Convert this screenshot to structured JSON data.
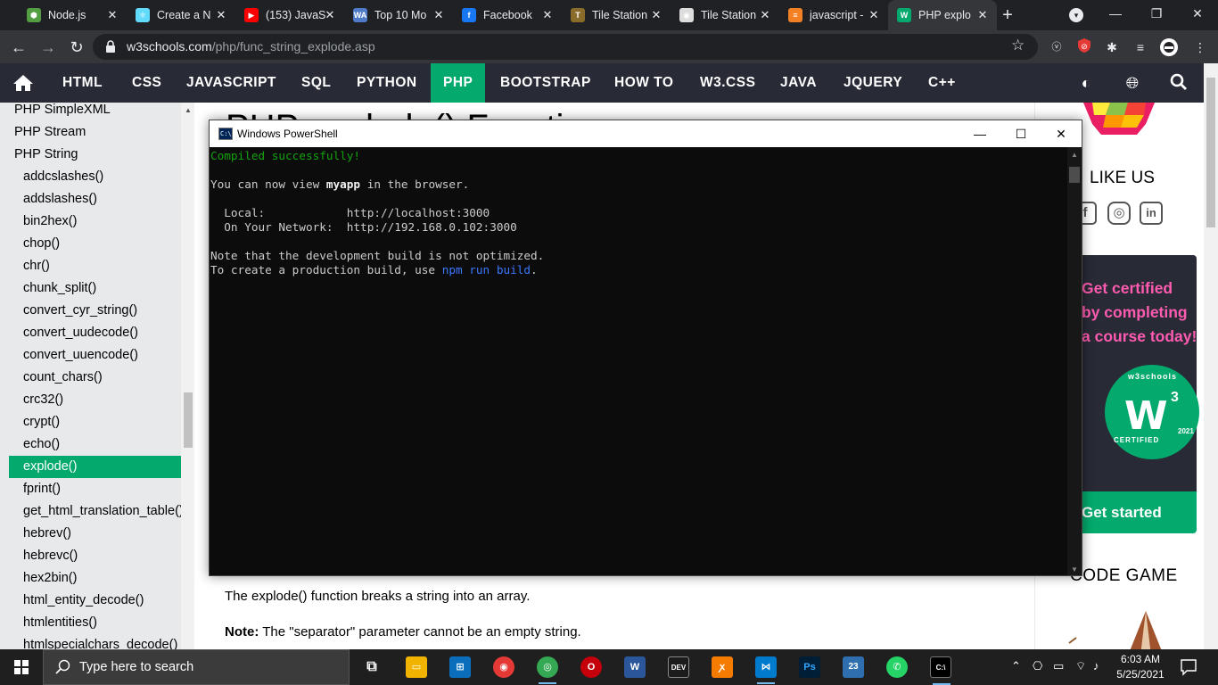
{
  "browser": {
    "tabs": [
      {
        "label": "Node.js",
        "icon": "nodejs-icon",
        "color": "#539e43",
        "glyph": "⬢"
      },
      {
        "label": "Create a N",
        "icon": "react-icon",
        "color": "#61dafb",
        "glyph": "⚛"
      },
      {
        "label": "(153) JavaS",
        "icon": "youtube-icon",
        "color": "#ff0000",
        "glyph": "▶"
      },
      {
        "label": "Top 10 Mo",
        "icon": "w3-logo-icon",
        "color": "#4e7cc9",
        "glyph": "WA"
      },
      {
        "label": "Facebook",
        "icon": "facebook-icon",
        "color": "#1877f2",
        "glyph": "f"
      },
      {
        "label": "Tile Station",
        "icon": "tile-station-icon",
        "color": "#8a6d2b",
        "glyph": "T"
      },
      {
        "label": "Tile Station",
        "icon": "globe-icon",
        "color": "#dddddd",
        "glyph": "◉"
      },
      {
        "label": "javascript -",
        "icon": "stackoverflow-icon",
        "color": "#f48024",
        "glyph": "≡"
      },
      {
        "label": "PHP explo",
        "icon": "w3schools-icon",
        "color": "#04aa6d",
        "glyph": "W"
      }
    ],
    "url_host": "w3schools.com",
    "url_path": "/php/func_string_explode.asp"
  },
  "w3nav": {
    "items": [
      "HTML",
      "CSS",
      "JAVASCRIPT",
      "SQL",
      "PYTHON",
      "PHP",
      "BOOTSTRAP",
      "HOW TO",
      "W3.CSS",
      "JAVA",
      "JQUERY",
      "C++"
    ],
    "active": "PHP"
  },
  "sidebar": {
    "top_items": [
      "PHP SimpleXML",
      "PHP Stream",
      "PHP String"
    ],
    "sub_items": [
      "addcslashes()",
      "addslashes()",
      "bin2hex()",
      "chop()",
      "chr()",
      "chunk_split()",
      "convert_cyr_string()",
      "convert_uudecode()",
      "convert_uuencode()",
      "count_chars()",
      "crc32()",
      "crypt()",
      "echo()",
      "explode()",
      "fprint()",
      "get_html_translation_table()",
      "hebrev()",
      "hebrevc()",
      "hex2bin()",
      "html_entity_decode()",
      "htmlentities()",
      "htmlspecialchars_decode()"
    ],
    "active": "explode()"
  },
  "main": {
    "heading_fragment": "PHP explode() Function",
    "para1": "The explode() function breaks a string into an array.",
    "note_label": "Note:",
    "note_text": " The \"separator\" parameter cannot be an empty string."
  },
  "right": {
    "like_us": "LIKE US",
    "cert_lines": [
      "Get certified",
      "by completing",
      "a course today!"
    ],
    "badge_ring": "w3schools",
    "badge_logo": "W",
    "badge_sup": "3",
    "badge_certified": "CERTIFIED",
    "badge_year": "2021",
    "get_started": "Get started",
    "code_game": "CODE GAME"
  },
  "powershell": {
    "title": "Windows PowerShell",
    "compiled": "Compiled successfully!",
    "view_pre": "You can now view ",
    "view_app": "myapp",
    "view_post": " in the browser.",
    "local_label": "  Local:            ",
    "local_url": "http://localhost:3000",
    "network_label": "  On Your Network:  ",
    "network_url": "http://192.168.0.102:3000",
    "note1": "Note that the development build is not optimized.",
    "note2_pre": "To create a production build, use ",
    "note2_cmd": "npm run build",
    "note2_post": "."
  },
  "taskbar": {
    "search_placeholder": "Type here to search",
    "time": "6:03 AM",
    "date": "5/25/2021",
    "badge_count": "23"
  }
}
